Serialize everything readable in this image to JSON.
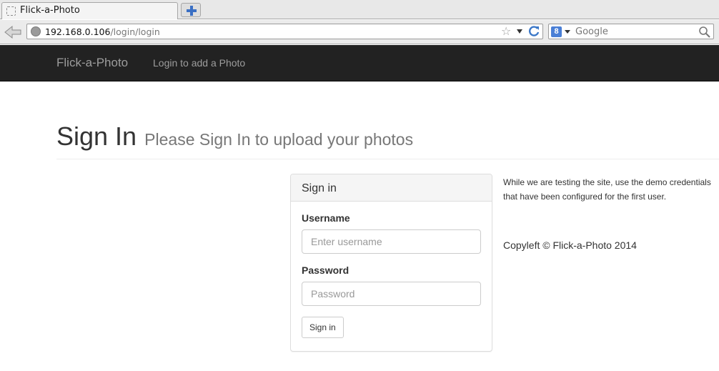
{
  "browser": {
    "tab_title": "Flick-a-Photo",
    "url_host": "192.168.0.106",
    "url_path": "/login/login",
    "search_placeholder": "Google",
    "search_engine_letter": "8"
  },
  "site_nav": {
    "brand": "Flick-a-Photo",
    "link": "Login to add a Photo"
  },
  "page": {
    "title": "Sign In",
    "subtitle": "Please Sign In to upload your photos"
  },
  "panel": {
    "heading": "Sign in",
    "username_label": "Username",
    "username_placeholder": "Enter username",
    "password_label": "Password",
    "password_placeholder": "Password",
    "submit_label": "Sign in"
  },
  "side": {
    "note": "While we are testing the site, use the demo credentials that have been configured for the first user.",
    "copyleft": "Copyleft © Flick-a-Photo 2014"
  }
}
